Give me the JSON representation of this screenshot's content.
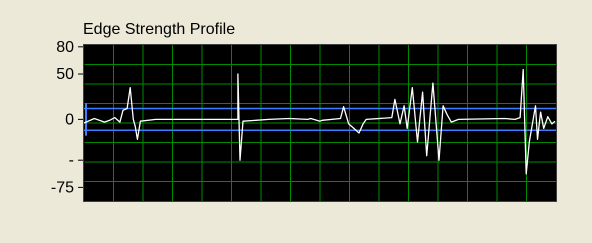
{
  "panel": {
    "background_color": "#ece9d8"
  },
  "graph": {
    "title": "Edge Strength Profile",
    "plot_background_color": "#000000",
    "grid_color": "#008a00",
    "trace_color": "#ffffff",
    "cursor_color": "#3d7dff"
  },
  "chart_data": {
    "type": "line",
    "title": "Edge Strength Profile",
    "xlabel": "",
    "ylabel": "",
    "ylim": [
      -90,
      82
    ],
    "y_ticks": [
      {
        "value": 80,
        "label": "80"
      },
      {
        "value": 50,
        "label": "50"
      },
      {
        "value": 0,
        "label": "0"
      },
      {
        "value": -45,
        "label": "-"
      },
      {
        "value": -75,
        "label": "-75"
      }
    ],
    "grid": true,
    "threshold_lines": [
      12,
      -12
    ],
    "series": [
      {
        "values": [
          [
            0,
            -4
          ],
          [
            10,
            1
          ],
          [
            20,
            -3
          ],
          [
            25,
            -1
          ],
          [
            30,
            2
          ],
          [
            35,
            -3
          ],
          [
            38,
            10
          ],
          [
            42,
            12
          ],
          [
            45,
            35
          ],
          [
            48,
            0
          ],
          [
            50,
            -8
          ],
          [
            52,
            -22
          ],
          [
            55,
            -2
          ],
          [
            70,
            0
          ],
          [
            100,
            0
          ],
          [
            150,
            0
          ],
          [
            150,
            50
          ],
          [
            152,
            -45
          ],
          [
            155,
            -2
          ],
          [
            180,
            0
          ],
          [
            200,
            1
          ],
          [
            218,
            0
          ],
          [
            221,
            1
          ],
          [
            230,
            -2
          ],
          [
            232,
            -1
          ],
          [
            250,
            1
          ],
          [
            253,
            14
          ],
          [
            258,
            -5
          ],
          [
            263,
            -10
          ],
          [
            268,
            -15
          ],
          [
            272,
            -5
          ],
          [
            275,
            0
          ],
          [
            300,
            2
          ],
          [
            303,
            22
          ],
          [
            308,
            -5
          ],
          [
            312,
            15
          ],
          [
            315,
            -10
          ],
          [
            320,
            35
          ],
          [
            325,
            -25
          ],
          [
            330,
            30
          ],
          [
            334,
            -40
          ],
          [
            340,
            40
          ],
          [
            346,
            -45
          ],
          [
            350,
            15
          ],
          [
            354,
            5
          ],
          [
            358,
            -3
          ],
          [
            365,
            0
          ],
          [
            410,
            1
          ],
          [
            420,
            0
          ],
          [
            425,
            2
          ],
          [
            428,
            55
          ],
          [
            431,
            -60
          ],
          [
            434,
            -25
          ],
          [
            437,
            -5
          ],
          [
            440,
            15
          ],
          [
            442,
            -22
          ],
          [
            445,
            8
          ],
          [
            448,
            -10
          ],
          [
            452,
            3
          ],
          [
            456,
            -5
          ],
          [
            459,
            -2
          ]
        ],
        "x_range": [
          0,
          460
        ]
      }
    ]
  }
}
